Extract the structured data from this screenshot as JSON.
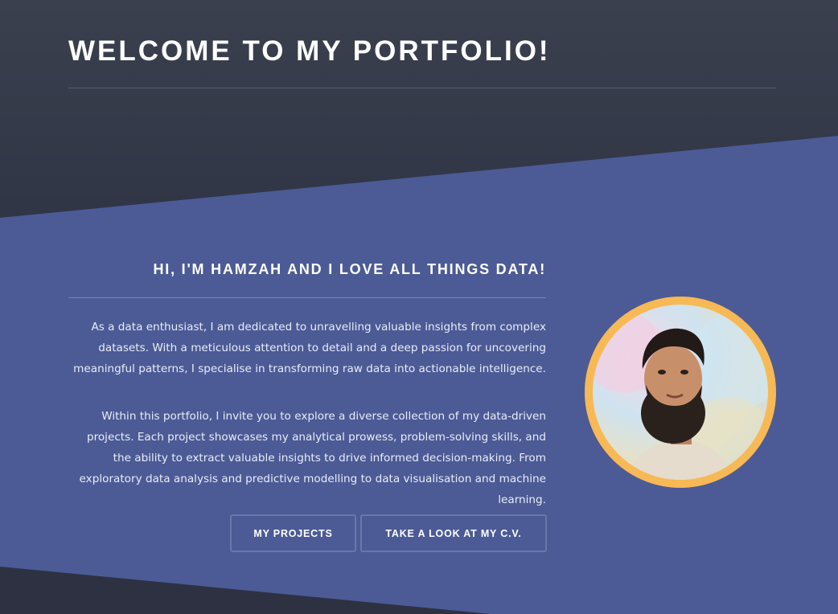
{
  "header": {
    "title": "WELCOME TO MY PORTFOLIO!"
  },
  "intro": {
    "subtitle": "HI, I'M HAMZAH AND I LOVE ALL THINGS DATA!",
    "paragraph_1": "As a data enthusiast, I am dedicated to unravelling valuable insights from complex datasets. With a meticulous attention to detail and a deep passion for uncovering meaningful patterns, I specialise in transforming raw data into actionable intelligence.",
    "paragraph_2": "Within this portfolio, I invite you to explore a diverse collection of my data-driven projects. Each project showcases my analytical prowess, problem-solving skills, and the ability to extract valuable insights to drive informed decision-making. From exploratory data analysis and predictive modelling to data visualisation and machine learning."
  },
  "buttons": {
    "projects_label": "MY PROJECTS",
    "cv_label": "TAKE A LOOK AT MY C.V."
  },
  "avatar": {
    "icon": "profile-photo",
    "ring_color": "#f7b955"
  },
  "colors": {
    "background_dark": "#2f3444",
    "band_blue": "#4c5b96",
    "accent": "#f7b955"
  }
}
